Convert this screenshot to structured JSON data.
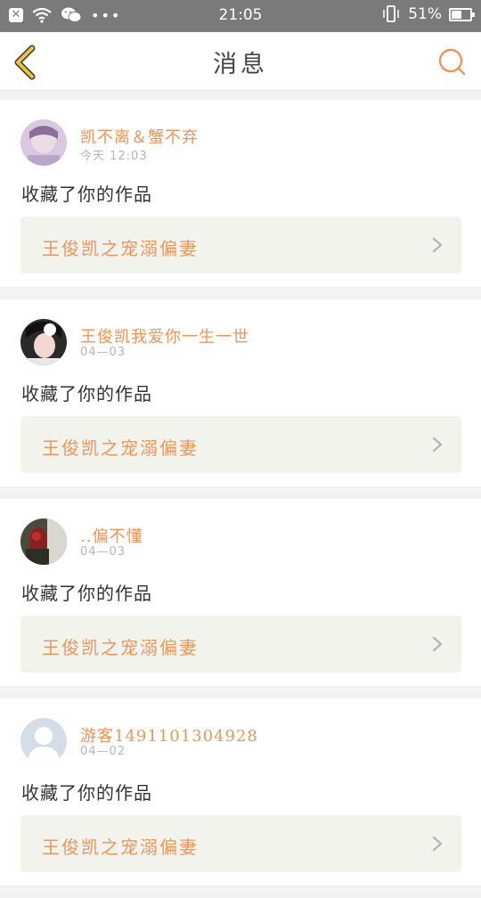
{
  "status_bar": {
    "time": "21:05",
    "battery": "51%",
    "icons": [
      "notification-x-icon",
      "wifi-icon",
      "wechat-icon",
      "more-dots-icon",
      "vibrate-icon",
      "battery-icon"
    ]
  },
  "header": {
    "title": "消息",
    "back_icon": "back-chevron-icon",
    "search_icon": "search-icon"
  },
  "colors": {
    "accent": "#f0955a",
    "back_icon": "#f0c040",
    "status_bar_bg": "#7a7a7a"
  },
  "messages": [
    {
      "username": "凯不离＆蟹不弃",
      "date": "今天 12:03",
      "action": "收藏了你的作品",
      "work_title": "王俊凯之宠溺偏妻"
    },
    {
      "username": "王俊凯我爱你一生一世",
      "date": "04—03",
      "action": "收藏了你的作品",
      "work_title": "王俊凯之宠溺偏妻"
    },
    {
      "username": "..偏不懂",
      "date": "04—03",
      "action": "收藏了你的作品",
      "work_title": "王俊凯之宠溺偏妻"
    },
    {
      "username": "游客1491101304928",
      "date": "04—02",
      "action": "收藏了你的作品",
      "work_title": "王俊凯之宠溺偏妻"
    }
  ]
}
